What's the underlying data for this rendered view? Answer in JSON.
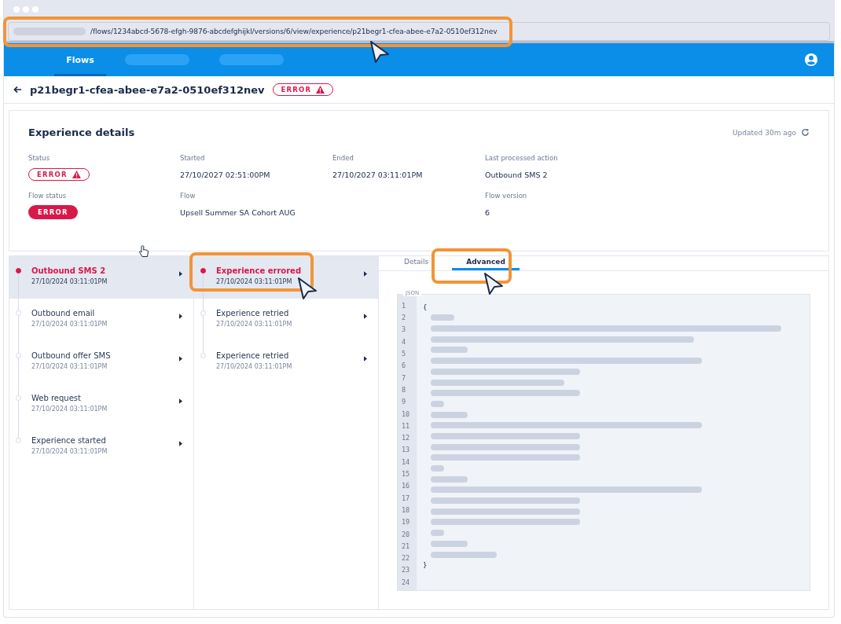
{
  "browser": {
    "address": "/flows/1234abcd-5678-efgh-9876-abcdefghijkl/versions/6/view/experience/p21begr1-cfea-abee-e7a2-0510ef312nev"
  },
  "nav": {
    "tabs": [
      {
        "kind": "text",
        "label": "Flows",
        "selected": true
      },
      {
        "kind": "blank",
        "selected": false
      },
      {
        "kind": "blank",
        "selected": false
      }
    ]
  },
  "header": {
    "title": "p21begr1-cfea-abee-e7a2-0510ef312nev",
    "status": {
      "kind": "outline",
      "label": "ERROR"
    }
  },
  "details": {
    "title": "Experience details",
    "updated": "Updated 30m ago",
    "rows": [
      [
        {
          "kind": "badge",
          "label": "Status",
          "badge": {
            "kind": "outline",
            "label": "ERROR"
          }
        },
        {
          "kind": "text",
          "label": "Started",
          "value": "27/10/2027 02:51:00PM"
        },
        {
          "kind": "text",
          "label": "Ended",
          "value": "27/10/2027 03:11:01PM"
        },
        {
          "kind": "text",
          "label": "Last processed action",
          "value": "Outbound SMS 2"
        }
      ],
      [
        {
          "kind": "badge",
          "label": "Flow status",
          "badge": {
            "kind": "solid",
            "label": "ERROR"
          }
        },
        {
          "kind": "text",
          "label": "Flow",
          "value": "Upsell Summer SA Cohort AUG"
        },
        {
          "kind": "gap"
        },
        {
          "kind": "text",
          "label": "Flow version",
          "value": "6"
        }
      ]
    ]
  },
  "actions": [
    {
      "title": "Outbound SMS 2",
      "time": "27/10/2024 03:11:01PM",
      "selected": true
    },
    {
      "title": "Outbound email",
      "time": "27/10/2024 03:11:01PM",
      "selected": false
    },
    {
      "title": "Outbound offer SMS",
      "time": "27/10/2024 03:11:01PM",
      "selected": false
    },
    {
      "title": "Web request",
      "time": "27/10/2024 03:11:01PM",
      "selected": false
    },
    {
      "title": "Experience started",
      "time": "27/10/2024 03:11:01PM",
      "selected": false
    }
  ],
  "events": [
    {
      "title": "Experience errored",
      "time": "27/10/2024 03:11:01PM",
      "selected": true
    },
    {
      "title": "Experience retried",
      "time": "27/10/2024 03:11:01PM",
      "selected": false
    },
    {
      "title": "Experience retried",
      "time": "27/10/2024 03:11:01PM",
      "selected": false
    }
  ],
  "tabs": [
    {
      "label": "Details",
      "selected": false
    },
    {
      "label": "Advanced",
      "selected": true
    }
  ],
  "code": {
    "label": "JSON",
    "line_numbers": [
      "1",
      "2",
      "3",
      "4",
      "5",
      "6",
      "7",
      "8",
      "9",
      "10",
      "11",
      "12",
      "13",
      "14",
      "15",
      "16",
      "17",
      "18",
      "19",
      "20",
      "21",
      "22",
      "23",
      "24"
    ],
    "lines": [
      {
        "kind": "text",
        "text": "{"
      },
      {
        "kind": "skeleton"
      },
      {
        "kind": "skeleton"
      },
      {
        "kind": "skeleton"
      },
      {
        "kind": "skeleton"
      },
      {
        "kind": "skeleton"
      },
      {
        "kind": "skeleton"
      },
      {
        "kind": "skeleton"
      },
      {
        "kind": "skeleton"
      },
      {
        "kind": "skeleton"
      },
      {
        "kind": "skeleton"
      },
      {
        "kind": "skeleton"
      },
      {
        "kind": "skeleton"
      },
      {
        "kind": "skeleton"
      },
      {
        "kind": "skeleton"
      },
      {
        "kind": "skeleton"
      },
      {
        "kind": "skeleton"
      },
      {
        "kind": "skeleton"
      },
      {
        "kind": "skeleton"
      },
      {
        "kind": "skeleton"
      },
      {
        "kind": "skeleton"
      },
      {
        "kind": "skeleton"
      },
      {
        "kind": "skeleton"
      },
      {
        "kind": "skeleton"
      },
      {
        "kind": "text",
        "text": "}"
      }
    ]
  }
}
